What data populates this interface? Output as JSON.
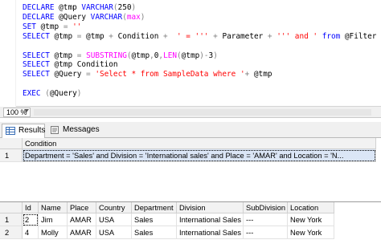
{
  "editor": {
    "lines": [
      [
        {
          "c": "kw",
          "t": "DECLARE"
        },
        {
          "c": "tx",
          "t": " @tmp "
        },
        {
          "c": "kw",
          "t": "VARCHAR"
        },
        {
          "c": "op",
          "t": "("
        },
        {
          "c": "tx",
          "t": "250"
        },
        {
          "c": "op",
          "t": ")"
        }
      ],
      [
        {
          "c": "kw",
          "t": "DECLARE"
        },
        {
          "c": "tx",
          "t": " @Query "
        },
        {
          "c": "kw",
          "t": "VARCHAR"
        },
        {
          "c": "op",
          "t": "("
        },
        {
          "c": "fn",
          "t": "max"
        },
        {
          "c": "op",
          "t": ")"
        }
      ],
      [
        {
          "c": "kw",
          "t": "SET"
        },
        {
          "c": "tx",
          "t": " @tmp "
        },
        {
          "c": "op",
          "t": "="
        },
        {
          "c": "tx",
          "t": " "
        },
        {
          "c": "str",
          "t": "''"
        }
      ],
      [
        {
          "c": "kw",
          "t": "SELECT"
        },
        {
          "c": "tx",
          "t": " @tmp "
        },
        {
          "c": "op",
          "t": "="
        },
        {
          "c": "tx",
          "t": " @tmp "
        },
        {
          "c": "op",
          "t": "+"
        },
        {
          "c": "tx",
          "t": " Condition "
        },
        {
          "c": "op",
          "t": "+"
        },
        {
          "c": "tx",
          "t": "  "
        },
        {
          "c": "str",
          "t": "' = '''"
        },
        {
          "c": "tx",
          "t": " "
        },
        {
          "c": "op",
          "t": "+"
        },
        {
          "c": "tx",
          "t": " Parameter "
        },
        {
          "c": "op",
          "t": "+"
        },
        {
          "c": "tx",
          "t": " "
        },
        {
          "c": "str",
          "t": "''' and '"
        },
        {
          "c": "tx",
          "t": " "
        },
        {
          "c": "kw",
          "t": "from"
        },
        {
          "c": "tx",
          "t": " @Filter"
        }
      ],
      [],
      [
        {
          "c": "kw",
          "t": "SELECT"
        },
        {
          "c": "tx",
          "t": " @tmp "
        },
        {
          "c": "op",
          "t": "="
        },
        {
          "c": "tx",
          "t": " "
        },
        {
          "c": "fn",
          "t": "SUBSTRING"
        },
        {
          "c": "op",
          "t": "("
        },
        {
          "c": "tx",
          "t": "@tmp"
        },
        {
          "c": "op",
          "t": ","
        },
        {
          "c": "tx",
          "t": "0"
        },
        {
          "c": "op",
          "t": ","
        },
        {
          "c": "fn",
          "t": "LEN"
        },
        {
          "c": "op",
          "t": "("
        },
        {
          "c": "tx",
          "t": "@tmp"
        },
        {
          "c": "op",
          "t": ")-"
        },
        {
          "c": "tx",
          "t": "3"
        },
        {
          "c": "op",
          "t": ")"
        }
      ],
      [
        {
          "c": "kw",
          "t": "SELECT"
        },
        {
          "c": "tx",
          "t": " @tmp Condition"
        }
      ],
      [
        {
          "c": "kw",
          "t": "SELECT"
        },
        {
          "c": "tx",
          "t": " @Query "
        },
        {
          "c": "op",
          "t": "="
        },
        {
          "c": "tx",
          "t": " "
        },
        {
          "c": "str",
          "t": "'Select * from SampleData where '"
        },
        {
          "c": "op",
          "t": "+"
        },
        {
          "c": "tx",
          "t": " @tmp"
        }
      ],
      [],
      [
        {
          "c": "kw",
          "t": "EXEC"
        },
        {
          "c": "tx",
          "t": " "
        },
        {
          "c": "op",
          "t": "("
        },
        {
          "c": "tx",
          "t": "@Query"
        },
        {
          "c": "op",
          "t": ")"
        }
      ]
    ],
    "zoom": "100 %"
  },
  "tabs": {
    "results": "Results",
    "messages": "Messages"
  },
  "result1": {
    "columns": [
      "Condition"
    ],
    "rows": [
      {
        "num": "1",
        "cells": [
          "Department = 'Sales' and Division = 'International sales' and Place = 'AMAR' and Location = 'N..."
        ]
      }
    ]
  },
  "result2": {
    "columns": [
      "Id",
      "Name",
      "Place",
      "Country",
      "Department",
      "Division",
      "SubDivision",
      "Location"
    ],
    "rows": [
      {
        "num": "1",
        "cells": [
          "2",
          "Jim",
          "AMAR",
          "USA",
          "Sales",
          "International Sales",
          "---",
          "New York"
        ]
      },
      {
        "num": "2",
        "cells": [
          "4",
          "Molly",
          "AMAR",
          "USA",
          "Sales",
          "International Sales",
          "---",
          "New York"
        ]
      }
    ]
  },
  "colors": {
    "keyword": "#0000ff",
    "string": "#ff0000",
    "function": "#ff00ff",
    "operator": "#808080",
    "selection": "#dbe6f6"
  }
}
